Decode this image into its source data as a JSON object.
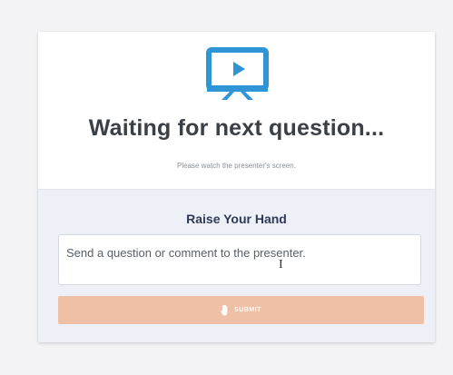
{
  "status": {
    "title": "Waiting for next question...",
    "subtitle": "Please watch the presenter's screen.",
    "icon": "presentation-screen-icon"
  },
  "raise_hand": {
    "title": "Raise Your Hand",
    "input_placeholder": "Send a question or comment to the presenter.",
    "submit_label": "SUBMIT",
    "submit_icon": "hand-icon"
  },
  "colors": {
    "accent_blue": "#2f95d6",
    "submit_bg": "#efbfa6",
    "panel_bg": "#eef0f8"
  }
}
